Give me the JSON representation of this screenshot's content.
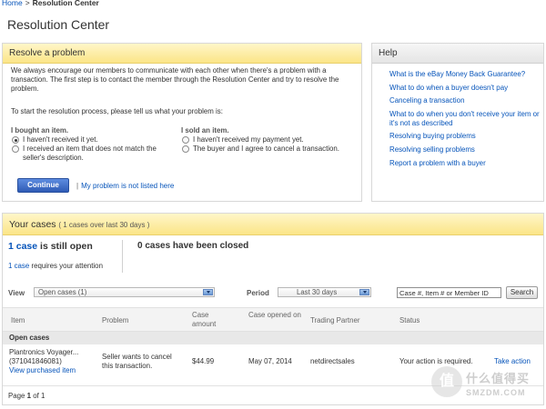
{
  "breadcrumb": {
    "home": "Home",
    "separator": ">",
    "current": "Resolution Center"
  },
  "page_title": "Resolution Center",
  "resolve": {
    "header": "Resolve a problem",
    "intro": "We always encourage our members to communicate with each other when there's a problem with a transaction. The first step is to contact the member through the Resolution Center and try to resolve the problem.",
    "prompt": "To start the resolution process, please tell us what your problem is:",
    "bought": {
      "title": "I bought an item.",
      "options": [
        {
          "label": "I haven't received it yet.",
          "checked": true
        },
        {
          "label": "I received an item that does not match the seller's description.",
          "checked": false
        }
      ]
    },
    "sold": {
      "title": "I sold an item.",
      "options": [
        {
          "label": "I haven't received my payment yet.",
          "checked": false
        },
        {
          "label": "The buyer and I agree to cancel a transaction.",
          "checked": false
        }
      ]
    },
    "continue_label": "Continue",
    "separator": "|",
    "not_listed_label": "My problem is not listed here"
  },
  "help": {
    "header": "Help",
    "links": [
      "What is the eBay Money Back Guarantee?",
      "What to do when a buyer doesn't pay",
      "Canceling a transaction",
      "What to do when you don't receive your item or it's not as described",
      "Resolving buying problems",
      "Resolving selling problems",
      "Report a problem with a buyer"
    ]
  },
  "cases": {
    "header": "Your cases",
    "header_sub": "( 1 cases over last 30 days )",
    "open_num": "1 case",
    "open_text": " is still open",
    "attention_num": "1 case",
    "attention_text": " requires your attention",
    "closed_text": "0 cases have been closed",
    "view_label": "View",
    "view_value": "Open cases (1)",
    "period_label": "Period",
    "period_value": "Last 30 days",
    "search_value": "Case #, Item # or Member ID",
    "search_button": "Search",
    "columns": [
      "Item",
      "Problem",
      "Case amount",
      "Case opened on",
      "Trading Partner",
      "Status"
    ],
    "group_label": "Open cases",
    "rows": [
      {
        "item_title": "Plantronics Voyager...",
        "item_number": "(371041846081)",
        "view_link": "View purchased item",
        "problem": "Seller wants to cancel this transaction.",
        "amount": "$44.99",
        "opened": "May 07, 2014",
        "partner": "netdirectsales",
        "status": "Your action is required.",
        "action": "Take action"
      }
    ],
    "pager_prefix": "Page ",
    "pager_current": "1",
    "pager_suffix": " of 1"
  },
  "watermark": {
    "badge": "值",
    "text": "什么值得买",
    "sub": "SMZDM.COM"
  }
}
